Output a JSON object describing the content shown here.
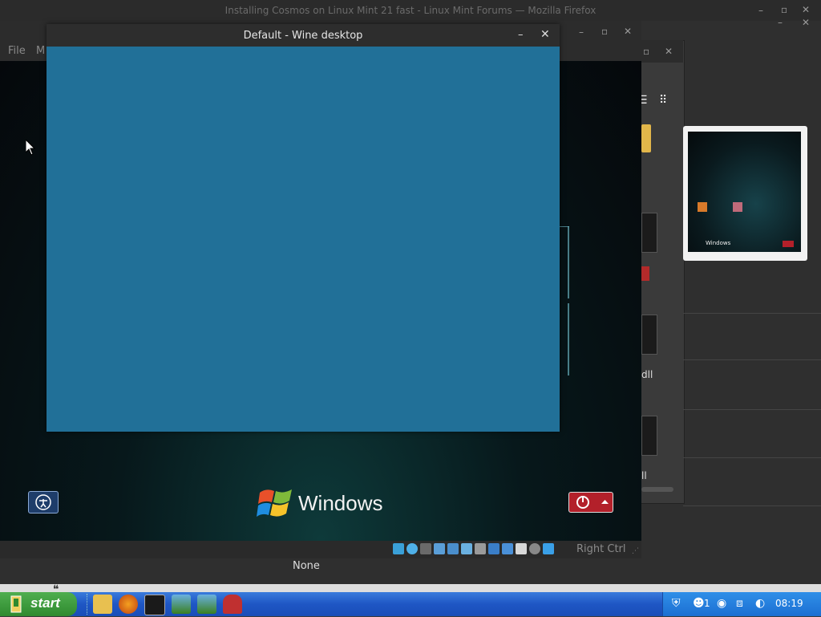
{
  "background_window": {
    "title": "Installing Cosmos on Linux Mint 21 fast - Linux Mint Forums — Mozilla Firefox",
    "min_glyph": "–",
    "max_glyph": "▫",
    "close_glyph": "✕"
  },
  "virtualbox": {
    "menu_file": "File",
    "menu_machine": "M",
    "host_key": "Right Ctrl",
    "status_icon_names": [
      "network-icon",
      "cd-icon",
      "floppy-icon",
      "audio-icon",
      "display-icon",
      "usb-icon",
      "shared-folder-icon",
      "recording-icon",
      "capture-icon",
      "mouse-icon",
      "keyboard-icon",
      "arrow-icon"
    ],
    "vm_bottom_label": "Windows",
    "footer_label": "None"
  },
  "wine_window": {
    "title": "Default - Wine desktop",
    "min_glyph": "–",
    "close_glyph": "✕",
    "background_color": "#217098"
  },
  "file_manager": {
    "label_dll": "dll",
    "label_ll": "ll",
    "thumbnail_caption": "Windows"
  },
  "taskbar": {
    "start_label": "start",
    "clock": "08:19",
    "tray_count": "1",
    "quick_launch_icons": [
      "folder-icon",
      "firefox-icon",
      "terminal-icon",
      "virtualbox-icon",
      "virtualbox-icon",
      "wine-icon"
    ]
  },
  "colors": {
    "taskbar_blue": "#1e56c4",
    "start_green": "#2f8a2f",
    "power_red": "#b3202a"
  }
}
